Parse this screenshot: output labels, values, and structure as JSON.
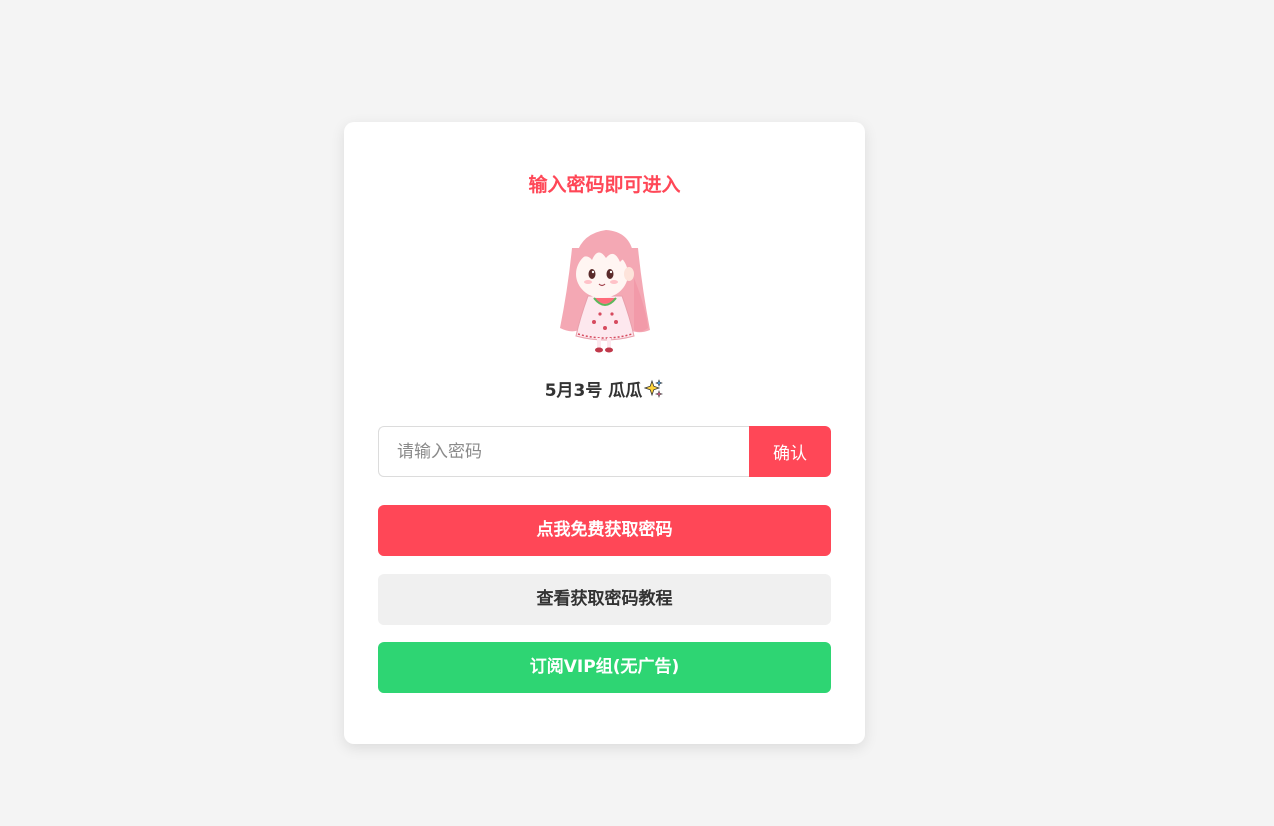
{
  "card": {
    "title": "输入密码即可进入",
    "date_text": "5月3号 瓜瓜",
    "sparkle_icon": "sparkles-icon"
  },
  "password": {
    "placeholder": "请输入密码",
    "value": "",
    "confirm_label": "确认"
  },
  "actions": {
    "free_password_label": "点我免费获取密码",
    "tutorial_label": "查看获取密码教程",
    "vip_label": "订阅VIP组(无广告)"
  },
  "colors": {
    "accent_red": "#ff4757",
    "vip_green": "#2ed573",
    "neutral_button": "#f0f0f0",
    "background": "#f4f4f4"
  }
}
